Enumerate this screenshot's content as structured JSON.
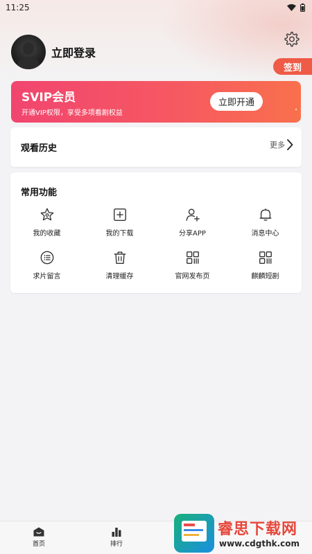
{
  "status_bar": {
    "time": "11:25"
  },
  "profile": {
    "login_label": "立即登录"
  },
  "signin_label": "签到",
  "svip": {
    "title": "SVIP会员",
    "subtitle": "开通VIP权限，享受多项看剧权益",
    "button_label": "立即开通"
  },
  "history": {
    "title": "观看历史",
    "more_label": "更多"
  },
  "functions": {
    "title": "常用功能",
    "items": [
      {
        "label": "我的收藏",
        "icon": "star-icon"
      },
      {
        "label": "我的下载",
        "icon": "download-box-icon"
      },
      {
        "label": "分享APP",
        "icon": "user-add-icon"
      },
      {
        "label": "消息中心",
        "icon": "bell-icon"
      },
      {
        "label": "求片留言",
        "icon": "list-icon"
      },
      {
        "label": "清理缓存",
        "icon": "trash-icon"
      },
      {
        "label": "官网发布页",
        "icon": "qr-icon"
      },
      {
        "label": "麒麟短剧",
        "icon": "qr-icon"
      }
    ]
  },
  "tabbar": {
    "tabs": [
      {
        "label": "首页",
        "icon": "home-icon"
      },
      {
        "label": "排行",
        "icon": "chart-bars-icon"
      }
    ]
  },
  "watermark": {
    "title": "睿思下载网",
    "url": "www.cdgthk.com"
  }
}
